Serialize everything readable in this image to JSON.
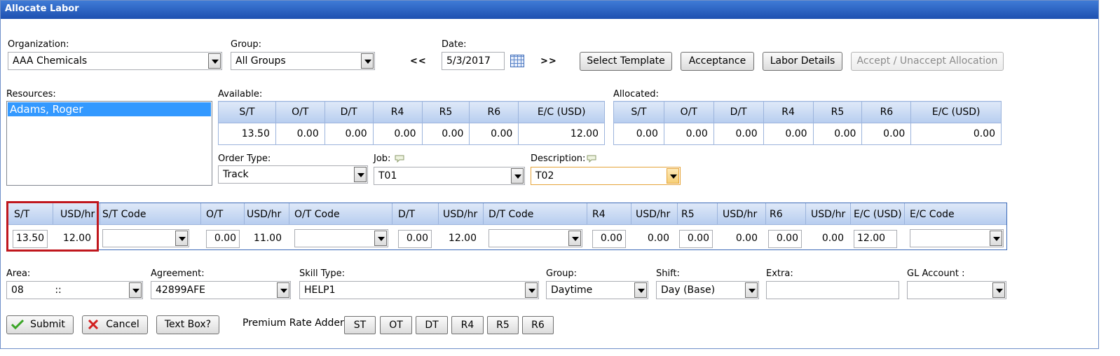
{
  "window": {
    "title": "Allocate Labor"
  },
  "header": {
    "organization_label": "Organization:",
    "organization_value": "AAA Chemicals",
    "group_label": "Group:",
    "group_value": "All Groups",
    "prev": "<<",
    "date_label": "Date:",
    "date_value": "5/3/2017",
    "next": ">>",
    "buttons": {
      "select_template": "Select Template",
      "acceptance": "Acceptance",
      "labor_details": "Labor Details",
      "accept_unaccept": "Accept / Unaccept Allocation"
    }
  },
  "resources": {
    "label": "Resources:",
    "items": [
      "Adams, Roger"
    ]
  },
  "available": {
    "label": "Available:",
    "columns": [
      "S/T",
      "O/T",
      "D/T",
      "R4",
      "R5",
      "R6",
      "E/C (USD)"
    ],
    "values": [
      "13.50",
      "0.00",
      "0.00",
      "0.00",
      "0.00",
      "0.00",
      "12.00"
    ]
  },
  "allocated": {
    "label": "Allocated:",
    "columns": [
      "S/T",
      "O/T",
      "D/T",
      "R4",
      "R5",
      "R6",
      "E/C (USD)"
    ],
    "values": [
      "0.00",
      "0.00",
      "0.00",
      "0.00",
      "0.00",
      "0.00",
      "0.00"
    ]
  },
  "order": {
    "order_type_label": "Order Type:",
    "order_type_value": "Track",
    "job_label": "Job:",
    "job_value": "T01",
    "description_label": "Description:",
    "description_value": "T02"
  },
  "entry": {
    "headers": [
      "S/T",
      "USD/hr",
      "S/T Code",
      "O/T",
      "USD/hr",
      "O/T Code",
      "D/T",
      "USD/hr",
      "D/T Code",
      "R4",
      "USD/hr",
      "R5",
      "USD/hr",
      "R6",
      "USD/hr",
      "E/C (USD)",
      "E/C Code"
    ],
    "st": "13.50",
    "st_rate": "12.00",
    "ot": "0.00",
    "ot_rate": "11.00",
    "dt": "0.00",
    "dt_rate": "12.00",
    "r4": "0.00",
    "r4_rate": "0.00",
    "r5": "0.00",
    "r5_rate": "0.00",
    "r6": "0.00",
    "r6_rate": "0.00",
    "ec": "12.00"
  },
  "details": {
    "area_label": "Area:",
    "area_value": "08          ::",
    "agreement_label": "Agreement:",
    "agreement_value": "42899AFE",
    "skill_label": "Skill Type:",
    "skill_value": "HELP1",
    "group_label": "Group:",
    "group_value": "Daytime",
    "shift_label": "Shift:",
    "shift_value": "Day (Base)",
    "extra_label": "Extra:",
    "gl_label": "GL Account :"
  },
  "footer": {
    "submit": "Submit",
    "cancel": "Cancel",
    "textbox": "Text Box?",
    "premium_label": "Premium Rate Adders",
    "premium": [
      "ST",
      "OT",
      "DT",
      "R4",
      "R5",
      "R6"
    ]
  },
  "colors": {
    "title_bar": "#1d4fb0",
    "highlight": "#c0171d",
    "selection": "#3399ff"
  }
}
